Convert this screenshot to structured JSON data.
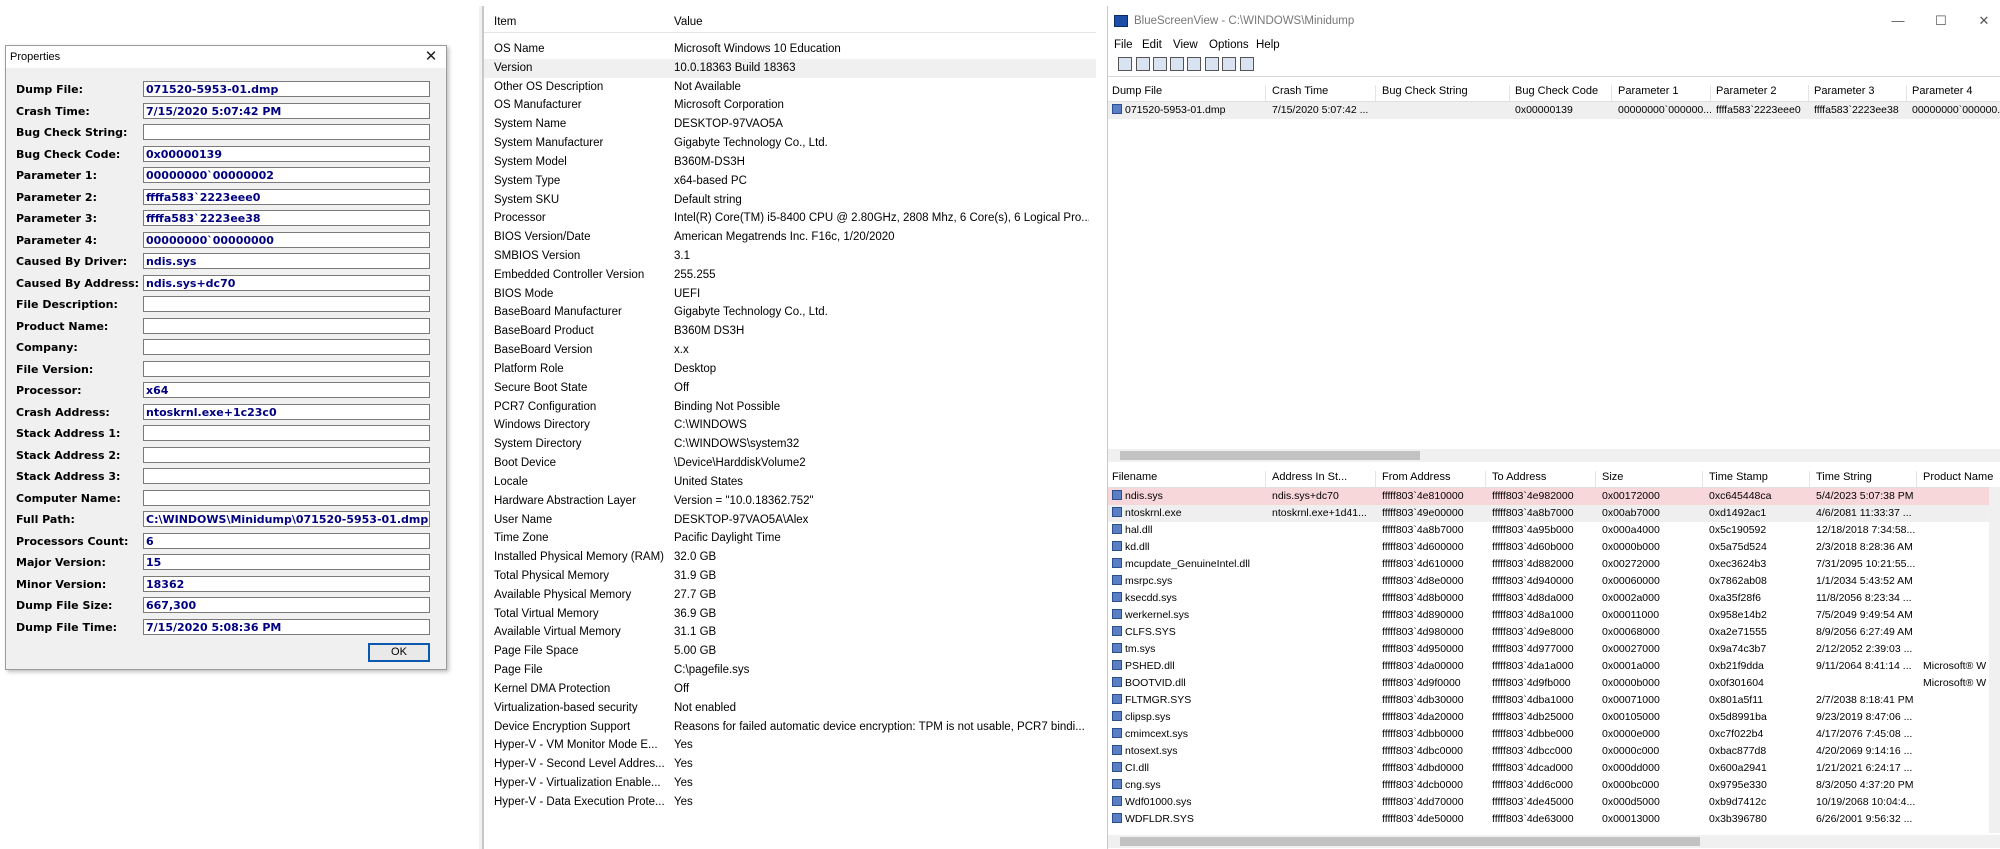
{
  "properties": {
    "title": "Properties",
    "ok_label": "OK",
    "rows": [
      {
        "label": "Dump File:",
        "value": "071520-5953-01.dmp"
      },
      {
        "label": "Crash Time:",
        "value": "7/15/2020 5:07:42 PM"
      },
      {
        "label": "Bug Check String:",
        "value": ""
      },
      {
        "label": "Bug Check Code:",
        "value": "0x00000139"
      },
      {
        "label": "Parameter 1:",
        "value": "00000000`00000002"
      },
      {
        "label": "Parameter 2:",
        "value": "ffffa583`2223eee0"
      },
      {
        "label": "Parameter 3:",
        "value": "ffffa583`2223ee38"
      },
      {
        "label": "Parameter 4:",
        "value": "00000000`00000000"
      },
      {
        "label": "Caused By Driver:",
        "value": "ndis.sys"
      },
      {
        "label": "Caused By Address:",
        "value": "ndis.sys+dc70"
      },
      {
        "label": "File Description:",
        "value": ""
      },
      {
        "label": "Product Name:",
        "value": ""
      },
      {
        "label": "Company:",
        "value": ""
      },
      {
        "label": "File Version:",
        "value": ""
      },
      {
        "label": "Processor:",
        "value": "x64"
      },
      {
        "label": "Crash Address:",
        "value": "ntoskrnl.exe+1c23c0"
      },
      {
        "label": "Stack Address 1:",
        "value": ""
      },
      {
        "label": "Stack Address 2:",
        "value": ""
      },
      {
        "label": "Stack Address 3:",
        "value": ""
      },
      {
        "label": "Computer Name:",
        "value": ""
      },
      {
        "label": "Full Path:",
        "value": "C:\\WINDOWS\\Minidump\\071520-5953-01.dmp"
      },
      {
        "label": "Processors Count:",
        "value": "6"
      },
      {
        "label": "Major Version:",
        "value": "15"
      },
      {
        "label": "Minor Version:",
        "value": "18362"
      },
      {
        "label": "Dump File Size:",
        "value": "667,300"
      },
      {
        "label": "Dump File Time:",
        "value": "7/15/2020 5:08:36 PM"
      }
    ]
  },
  "sysinfo": {
    "columns": {
      "item": "Item",
      "value": "Value"
    },
    "rows": [
      {
        "item": "OS Name",
        "value": "Microsoft Windows 10 Education"
      },
      {
        "item": "Version",
        "value": "10.0.18363 Build 18363"
      },
      {
        "item": "Other OS Description",
        "value": "Not Available"
      },
      {
        "item": "OS Manufacturer",
        "value": "Microsoft Corporation"
      },
      {
        "item": "System Name",
        "value": "DESKTOP-97VAO5A"
      },
      {
        "item": "System Manufacturer",
        "value": "Gigabyte Technology Co., Ltd."
      },
      {
        "item": "System Model",
        "value": "B360M-DS3H"
      },
      {
        "item": "System Type",
        "value": "x64-based PC"
      },
      {
        "item": "System SKU",
        "value": "Default string"
      },
      {
        "item": "Processor",
        "value": "Intel(R) Core(TM) i5-8400 CPU @ 2.80GHz, 2808 Mhz, 6 Core(s), 6 Logical Pro..."
      },
      {
        "item": "BIOS Version/Date",
        "value": "American Megatrends Inc. F16c, 1/20/2020"
      },
      {
        "item": "SMBIOS Version",
        "value": "3.1"
      },
      {
        "item": "Embedded Controller Version",
        "value": "255.255"
      },
      {
        "item": "BIOS Mode",
        "value": "UEFI"
      },
      {
        "item": "BaseBoard Manufacturer",
        "value": "Gigabyte Technology Co., Ltd."
      },
      {
        "item": "BaseBoard Product",
        "value": "B360M DS3H"
      },
      {
        "item": "BaseBoard Version",
        "value": "x.x"
      },
      {
        "item": "Platform Role",
        "value": "Desktop"
      },
      {
        "item": "Secure Boot State",
        "value": "Off"
      },
      {
        "item": "PCR7 Configuration",
        "value": "Binding Not Possible"
      },
      {
        "item": "Windows Directory",
        "value": "C:\\WINDOWS"
      },
      {
        "item": "System Directory",
        "value": "C:\\WINDOWS\\system32"
      },
      {
        "item": "Boot Device",
        "value": "\\Device\\HarddiskVolume2"
      },
      {
        "item": "Locale",
        "value": "United States"
      },
      {
        "item": "Hardware Abstraction Layer",
        "value": "Version = \"10.0.18362.752\""
      },
      {
        "item": "User Name",
        "value": "DESKTOP-97VAO5A\\Alex"
      },
      {
        "item": "Time Zone",
        "value": "Pacific Daylight Time"
      },
      {
        "item": "Installed Physical Memory (RAM)",
        "value": "32.0 GB"
      },
      {
        "item": "Total Physical Memory",
        "value": "31.9 GB"
      },
      {
        "item": "Available Physical Memory",
        "value": "27.7 GB"
      },
      {
        "item": "Total Virtual Memory",
        "value": "36.9 GB"
      },
      {
        "item": "Available Virtual Memory",
        "value": "31.1 GB"
      },
      {
        "item": "Page File Space",
        "value": "5.00 GB"
      },
      {
        "item": "Page File",
        "value": "C:\\pagefile.sys"
      },
      {
        "item": "Kernel DMA Protection",
        "value": "Off"
      },
      {
        "item": "Virtualization-based security",
        "value": "Not enabled"
      },
      {
        "item": "Device Encryption Support",
        "value": "Reasons for failed automatic device encryption: TPM is not usable, PCR7 bindi..."
      },
      {
        "item": "Hyper-V - VM Monitor Mode E...",
        "value": "Yes"
      },
      {
        "item": "Hyper-V - Second Level Addres...",
        "value": "Yes"
      },
      {
        "item": "Hyper-V - Virtualization Enable...",
        "value": "Yes"
      },
      {
        "item": "Hyper-V - Data Execution Prote...",
        "value": "Yes"
      }
    ]
  },
  "bsv": {
    "title": "BlueScreenView - C:\\WINDOWS\\Minidump",
    "menu": [
      "File",
      "Edit",
      "View",
      "Options",
      "Help"
    ],
    "toolbar_icons": [
      "properties-icon",
      "save-icon",
      "refresh-icon",
      "copy-icon",
      "copy-all-icon",
      "report-icon",
      "find-icon",
      "exit-icon"
    ],
    "dumps": {
      "columns": [
        "Dump File",
        "Crash Time",
        "Bug Check String",
        "Bug Check Code",
        "Parameter 1",
        "Parameter 2",
        "Parameter 3",
        "Parameter 4"
      ],
      "rows": [
        [
          "071520-5953-01.dmp",
          "7/15/2020 5:07:42 ...",
          "",
          "0x00000139",
          "00000000`000000...",
          "ffffa583`2223eee0",
          "ffffa583`2223ee38",
          "00000000`000000..."
        ]
      ]
    },
    "drivers": {
      "columns": [
        "Filename",
        "Address In St...",
        "From Address",
        "To Address",
        "Size",
        "Time Stamp",
        "Time String",
        "Product Name"
      ],
      "rows": [
        [
          "ndis.sys",
          "ndis.sys+dc70",
          "fffff803`4e810000",
          "fffff803`4e982000",
          "0x00172000",
          "0xc645448ca",
          "5/4/2023 5:07:38 PM",
          ""
        ],
        [
          "ntoskrnl.exe",
          "ntoskrnl.exe+1d41...",
          "fffff803`49e00000",
          "fffff803`4a8b7000",
          "0x00ab7000",
          "0xd1492ac1",
          "4/6/2081 11:33:37 ...",
          ""
        ],
        [
          "hal.dll",
          "",
          "fffff803`4a8b7000",
          "fffff803`4a95b000",
          "0x000a4000",
          "0x5c190592",
          "12/18/2018 7:34:58...",
          ""
        ],
        [
          "kd.dll",
          "",
          "fffff803`4d600000",
          "fffff803`4d60b000",
          "0x0000b000",
          "0x5a75d524",
          "2/3/2018 8:28:36 AM",
          ""
        ],
        [
          "mcupdate_GenuineIntel.dll",
          "",
          "fffff803`4d610000",
          "fffff803`4d882000",
          "0x00272000",
          "0xec3624b3",
          "7/31/2095 10:21:55...",
          ""
        ],
        [
          "msrpc.sys",
          "",
          "fffff803`4d8e0000",
          "fffff803`4d940000",
          "0x00060000",
          "0x7862ab08",
          "1/1/2034 5:43:52 AM",
          ""
        ],
        [
          "ksecdd.sys",
          "",
          "fffff803`4d8b0000",
          "fffff803`4d8da000",
          "0x0002a000",
          "0xa35f28f6",
          "11/8/2056 8:23:34 ...",
          ""
        ],
        [
          "werkernel.sys",
          "",
          "fffff803`4d890000",
          "fffff803`4d8a1000",
          "0x00011000",
          "0x958e14b2",
          "7/5/2049 9:49:54 AM",
          ""
        ],
        [
          "CLFS.SYS",
          "",
          "fffff803`4d980000",
          "fffff803`4d9e8000",
          "0x00068000",
          "0xa2e71555",
          "8/9/2056 6:27:49 AM",
          ""
        ],
        [
          "tm.sys",
          "",
          "fffff803`4d950000",
          "fffff803`4d977000",
          "0x00027000",
          "0x9a74c3b7",
          "2/12/2052 2:39:03 ...",
          ""
        ],
        [
          "PSHED.dll",
          "",
          "fffff803`4da00000",
          "fffff803`4da1a000",
          "0x0001a000",
          "0xb21f9dda",
          "9/11/2064 8:41:14 ...",
          "Microsoft® W"
        ],
        [
          "BOOTVID.dll",
          "",
          "fffff803`4d9f0000",
          "fffff803`4d9fb000",
          "0x0000b000",
          "0x0f301604",
          "",
          "Microsoft® W"
        ],
        [
          "FLTMGR.SYS",
          "",
          "fffff803`4db30000",
          "fffff803`4dba1000",
          "0x00071000",
          "0x801a5f11",
          "2/7/2038 8:18:41 PM",
          ""
        ],
        [
          "clipsp.sys",
          "",
          "fffff803`4da20000",
          "fffff803`4db25000",
          "0x00105000",
          "0x5d8991ba",
          "9/23/2019 8:47:06 ...",
          ""
        ],
        [
          "cmimcext.sys",
          "",
          "fffff803`4dbb0000",
          "fffff803`4dbbe000",
          "0x0000e000",
          "0xc7f022b4",
          "4/17/2076 7:45:08 ...",
          ""
        ],
        [
          "ntosext.sys",
          "",
          "fffff803`4dbc0000",
          "fffff803`4dbcc000",
          "0x0000c000",
          "0xbac877d8",
          "4/20/2069 9:14:16 ...",
          ""
        ],
        [
          "CI.dll",
          "",
          "fffff803`4dbd0000",
          "fffff803`4dcad000",
          "0x000dd000",
          "0x600a2941",
          "1/21/2021 6:24:17 ...",
          ""
        ],
        [
          "cng.sys",
          "",
          "fffff803`4dcb0000",
          "fffff803`4dd6c000",
          "0x000bc000",
          "0x9795e330",
          "8/3/2050 4:37:20 PM",
          ""
        ],
        [
          "Wdf01000.sys",
          "",
          "fffff803`4dd70000",
          "fffff803`4de45000",
          "0x000d5000",
          "0xb9d7412c",
          "10/19/2068 10:04:4...",
          ""
        ],
        [
          "WDFLDR.SYS",
          "",
          "fffff803`4de50000",
          "fffff803`4de63000",
          "0x00013000",
          "0x3b396780",
          "6/26/2001 9:56:32 ...",
          ""
        ]
      ]
    },
    "colors": {
      "highlight_row": "#f8d7da",
      "selected_row": "#efefef"
    }
  }
}
